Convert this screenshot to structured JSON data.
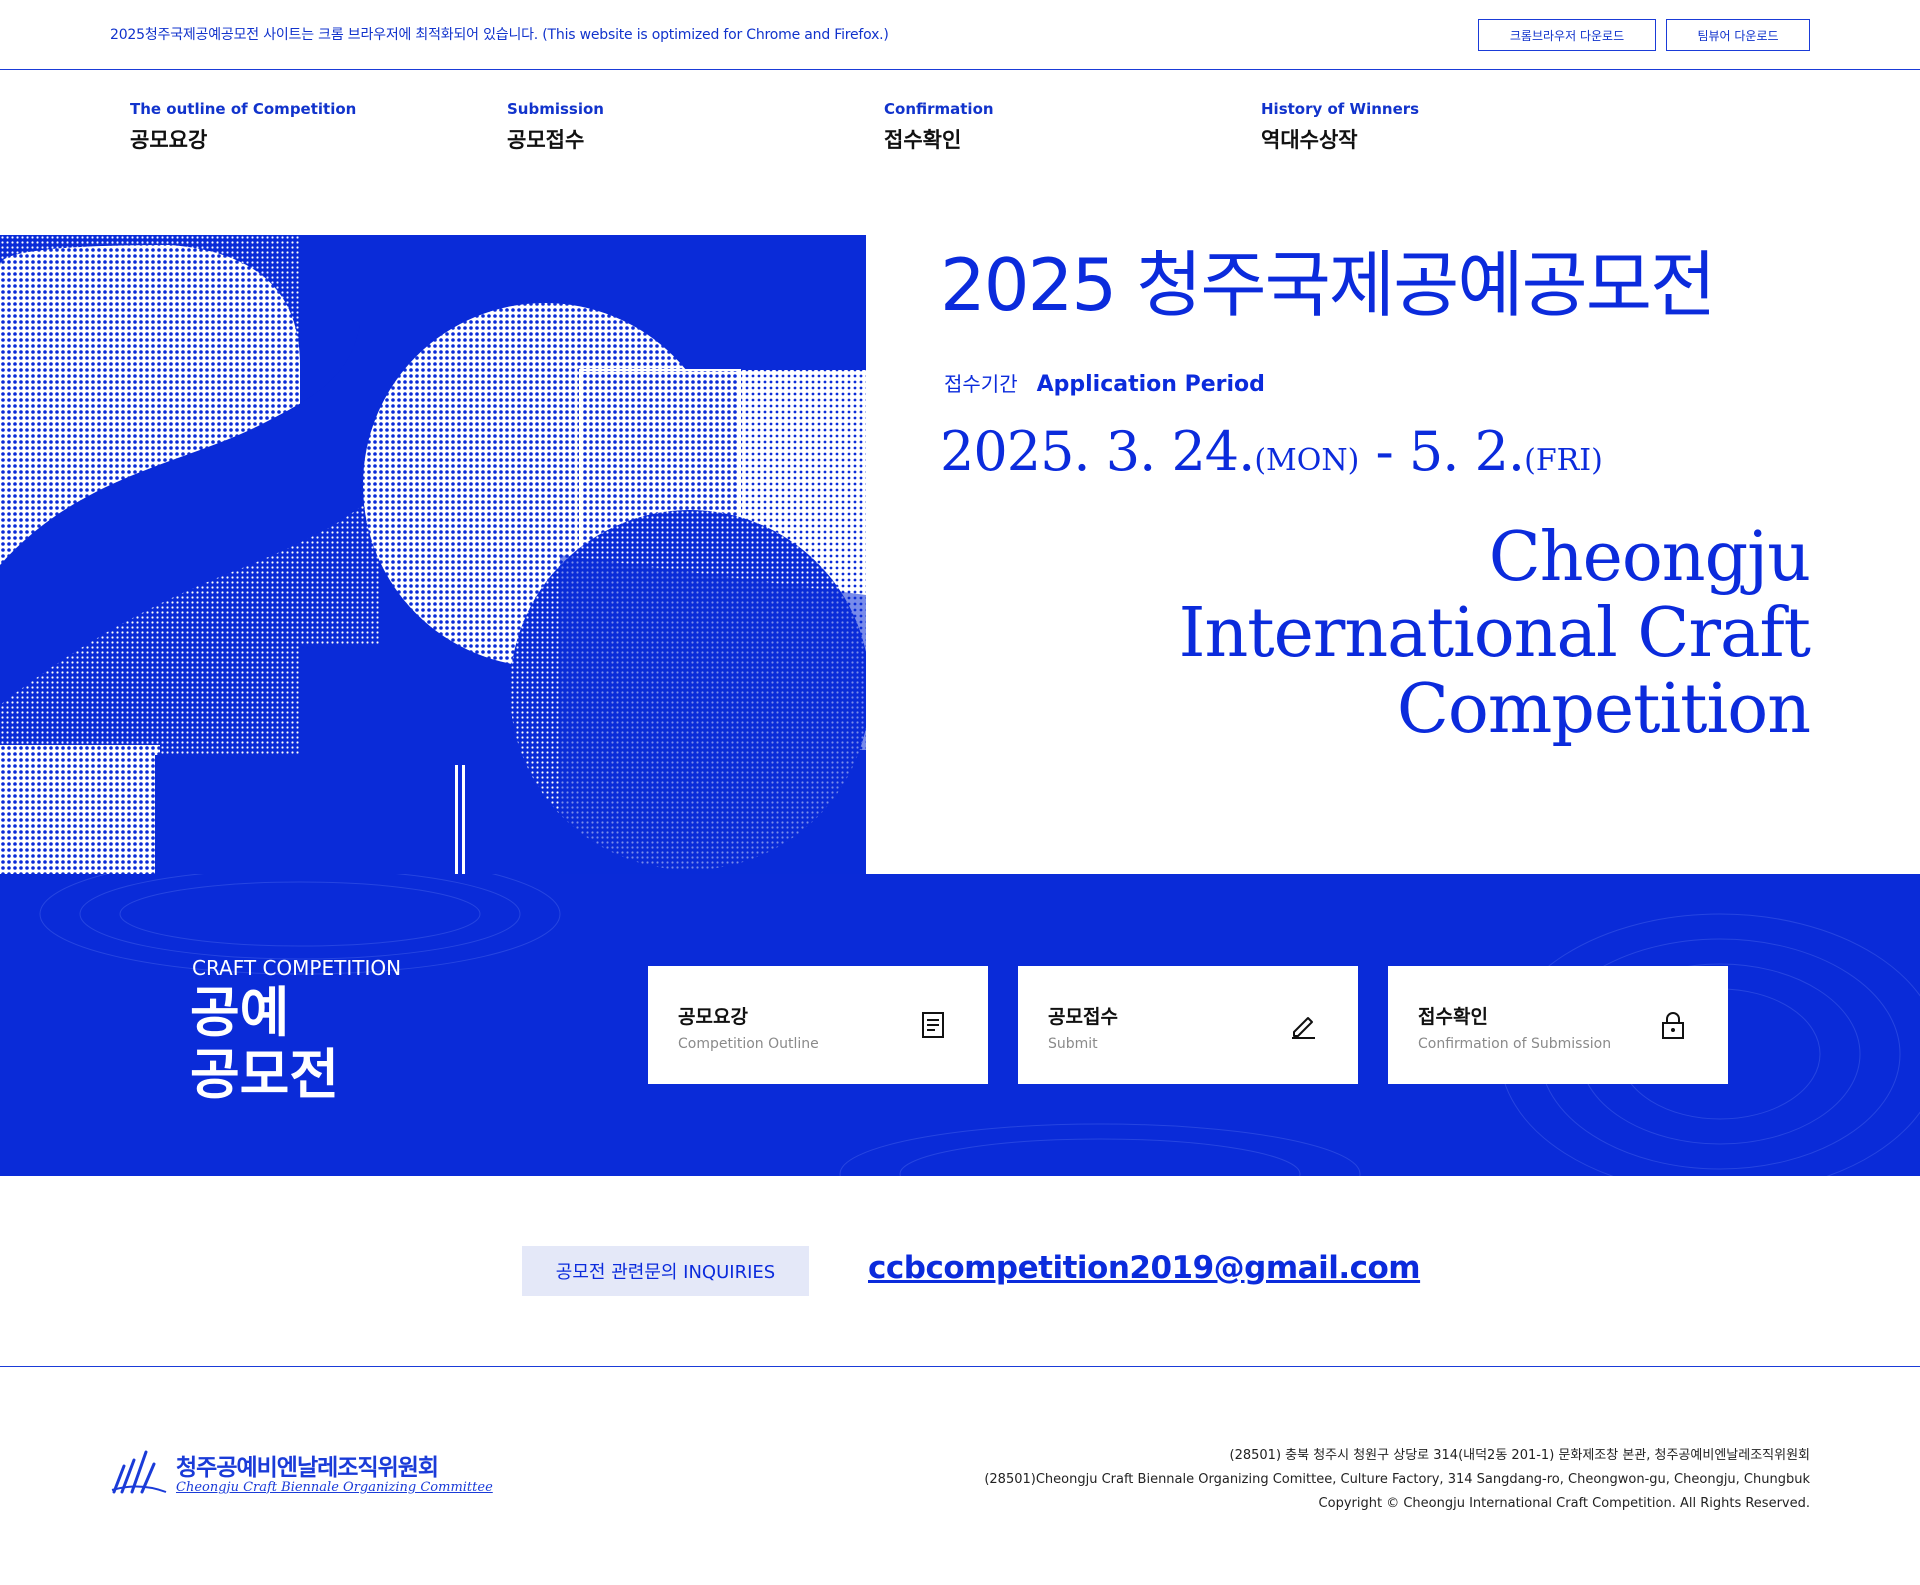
{
  "topbar": {
    "notice": "2025청주국제공예공모전 사이트는 크롬 브라우저에 최적화되어 있습니다. (This website is optimized for Chrome and Firefox.)",
    "chrome_button": "크롬브라우저 다운로드",
    "teamviewer_button": "팀뷰어 다운로드"
  },
  "nav": [
    {
      "en": "The outline of Competition",
      "ko": "공모요강"
    },
    {
      "en": "Submission",
      "ko": "공모접수"
    },
    {
      "en": "Confirmation",
      "ko": "접수확인"
    },
    {
      "en": "History of Winners",
      "ko": "역대수상작"
    }
  ],
  "hero": {
    "title": "2025 청주국제공예공모전",
    "period_label_ko": "접수기간",
    "period_label_en": "Application Period",
    "start": "2025. 3. 24.",
    "start_day": "(MON)",
    "sep": " - ",
    "end": "5. 2.",
    "end_day": "(FRI)",
    "en_line1": "Cheongju",
    "en_line2": "International Craft",
    "en_line3": "Competition"
  },
  "band": {
    "eyebrow": "CRAFT COMPETITION",
    "title_line1": "공예",
    "title_line2": "공모전",
    "cards": [
      {
        "title": "공모요강",
        "sub": "Competition Outline",
        "icon": "document-icon"
      },
      {
        "title": "공모접수",
        "sub": "Submit",
        "icon": "pencil-icon"
      },
      {
        "title": "접수확인",
        "sub": "Confirmation of Submission",
        "icon": "lock-icon"
      }
    ]
  },
  "inquiry": {
    "label": "공모전 관련문의 INQUIRIES",
    "email": "ccbcompetition2019@gmail.com"
  },
  "footer": {
    "logo_ko": "청주공예비엔날레조직위원회",
    "logo_en": "Cheongju Craft Biennale Organizing Committee",
    "address_ko": "(28501) 충북 청주시 청원구 상당로 314(내덕2동 201-1) 문화제조창 본관, 청주공예비엔날레조직위원회",
    "address_en": "(28501)Cheongju Craft Biennale Organizing Comittee, Culture Factory, 314 Sangdang-ro, Cheongwon-gu, Cheongju, Chungbuk",
    "copyright": "Copyright © Cheongju International Craft Competition. All Rights Reserved."
  },
  "colors": {
    "brand_blue": "#0a2bd8",
    "inquiry_bg": "#e4e8f8"
  }
}
